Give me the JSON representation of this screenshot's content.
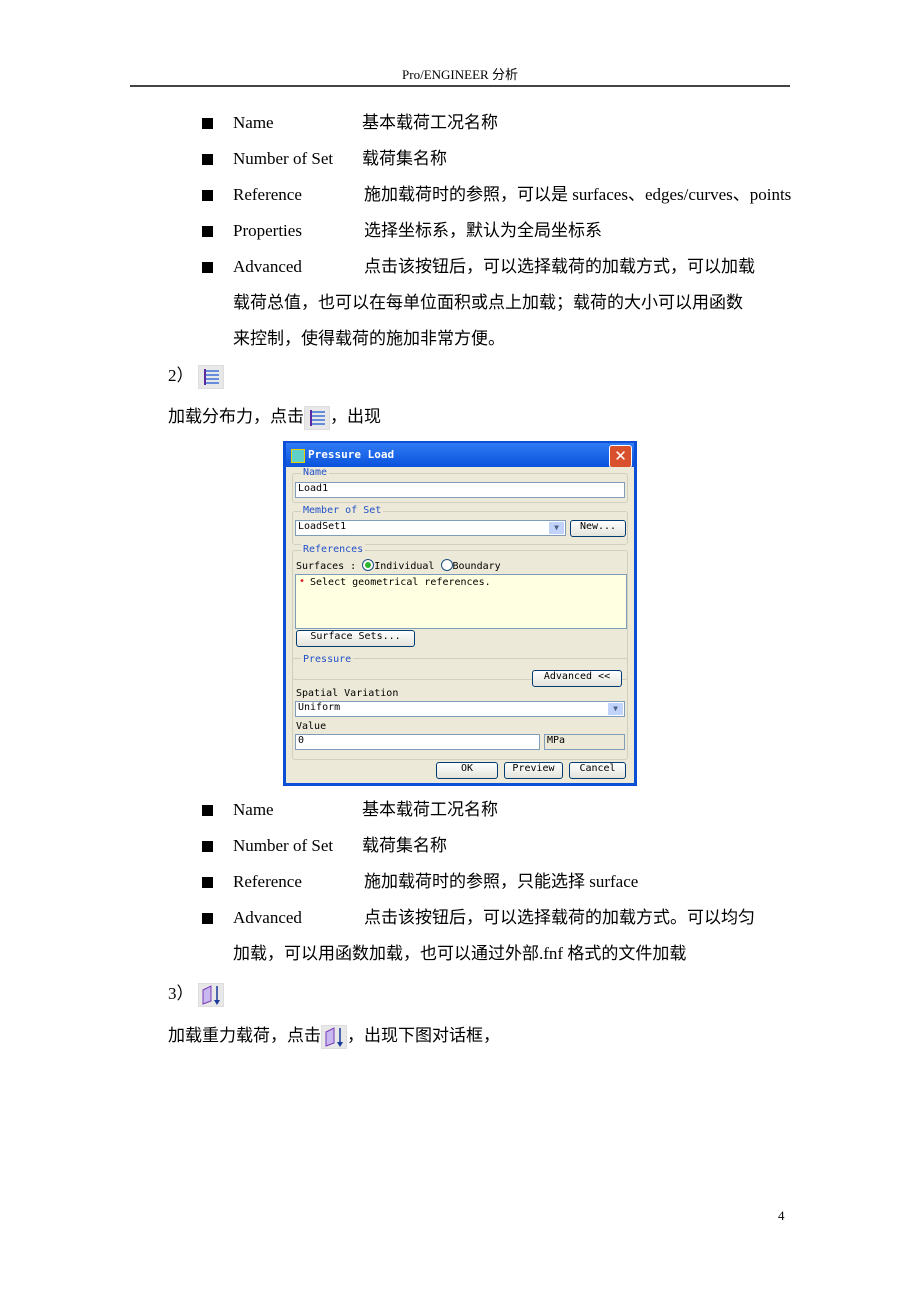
{
  "header": {
    "title": "Pro/ENGINEER 分析"
  },
  "section1": {
    "bullets": [
      {
        "term": "Name",
        "desc": "基本载荷工况名称"
      },
      {
        "term": "Number of Set",
        "desc": "载荷集名称"
      },
      {
        "term": "Reference",
        "desc": "施加载荷时的参照，可以是 surfaces、edges/curves、points"
      },
      {
        "term": "Properties",
        "desc": "选择坐标系，默认为全局坐标系"
      },
      {
        "term": "Advanced",
        "desc": "点击该按钮后，可以选择载荷的加载方式，可以加载"
      }
    ],
    "continuation": [
      "载荷总值，也可以在每单位面积或点上加载；载荷的大小可以用函数",
      "来控制，使得载荷的施加非常方便。"
    ]
  },
  "section2": {
    "number": "2）",
    "intro_before": "加载分布力，点击",
    "intro_after": "，出现"
  },
  "dialog": {
    "title": "Pressure Load",
    "name_label": "Name",
    "name_value": "Load1",
    "member_label": "Member of Set",
    "member_value": "LoadSet1",
    "new_button": "New...",
    "references_label": "References",
    "surfaces_label": "Surfaces :",
    "radio_individual": "Individual",
    "radio_boundary": "Boundary",
    "selected_radio": "Individual",
    "ref_message": "Select geometrical references.",
    "surface_sets_button": "Surface Sets...",
    "pressure_label": "Pressure",
    "advanced_button": "Advanced <<",
    "spatial_label": "Spatial Variation",
    "spatial_value": "Uniform",
    "value_label": "Value",
    "value_value": "0",
    "unit": "MPa",
    "ok_button": "OK",
    "preview_button": "Preview",
    "cancel_button": "Cancel"
  },
  "section2_bullets": {
    "bullets": [
      {
        "term": "Name",
        "desc": "基本载荷工况名称"
      },
      {
        "term": "Number of Set",
        "desc": "载荷集名称"
      },
      {
        "term": "Reference",
        "desc": "施加载荷时的参照，只能选择 surface"
      },
      {
        "term": "Advanced",
        "desc": "点击该按钮后，可以选择载荷的加载方式。可以均匀"
      }
    ],
    "continuation": [
      "加载，可以用函数加载，也可以通过外部.fnf 格式的文件加载"
    ]
  },
  "section3": {
    "number": "3）",
    "intro_before": "加载重力载荷，点击",
    "intro_after": "，出现下图对话框，"
  },
  "footer": {
    "page_number": "4"
  }
}
